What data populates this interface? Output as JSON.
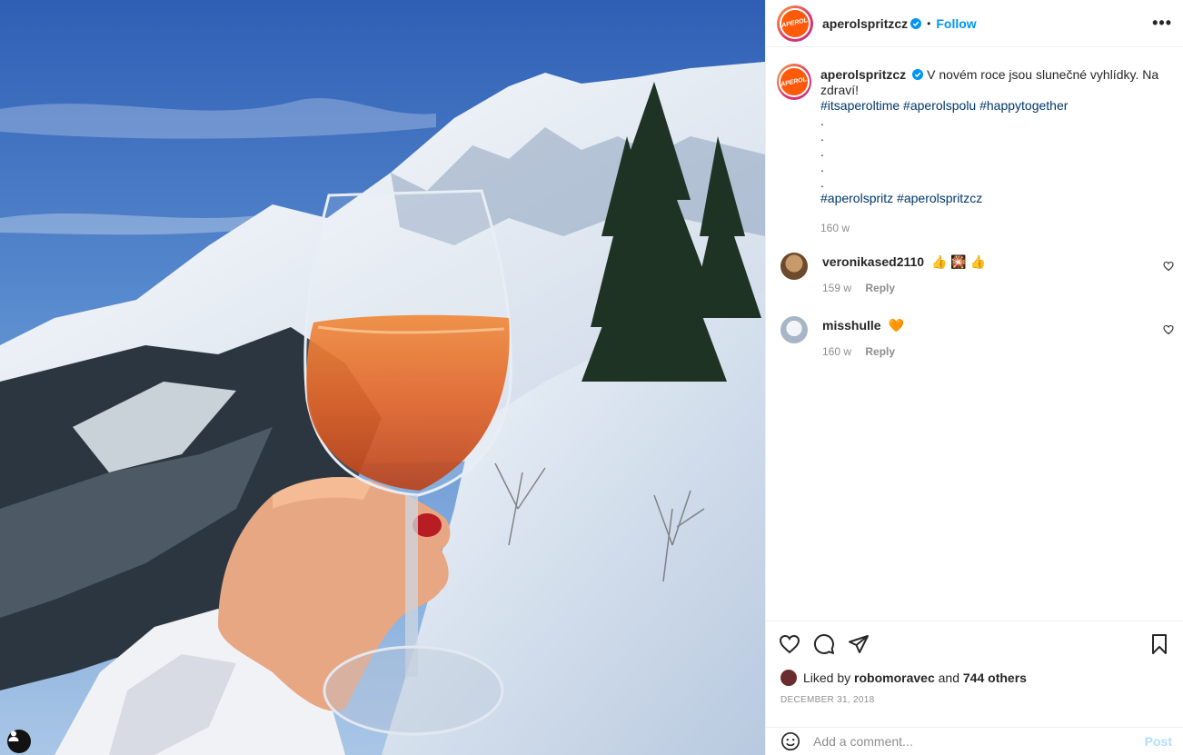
{
  "photo": {
    "alt_icon": "user-tag-icon"
  },
  "header": {
    "avatar_text": "APEROL",
    "username": "aperolspritzcz",
    "dot": "•",
    "follow_label": "Follow",
    "more_label": "•••"
  },
  "caption": {
    "avatar_text": "APEROL",
    "username": "aperolspritzcz",
    "text": "V novém roce jsou slunečné vyhlídky. Na zdraví!",
    "tags_line1": [
      "#itsaperoltime",
      "#aperolspolu",
      "#happytogether"
    ],
    "dots": [
      ".",
      ".",
      ".",
      ".",
      "."
    ],
    "tags_line2": [
      "#aperolspritz",
      "#aperolspritzcz"
    ],
    "time": "160 w"
  },
  "comments": [
    {
      "username": "veronikased2110",
      "text": "👍 🎇 👍",
      "time": "159 w",
      "reply": "Reply"
    },
    {
      "username": "misshulle",
      "text": "🧡",
      "time": "160 w",
      "reply": "Reply"
    }
  ],
  "likes": {
    "prefix": "Liked by",
    "user": "robomoravec",
    "and": "and",
    "others": "744 others"
  },
  "date": "DECEMBER 31, 2018",
  "comment_box": {
    "placeholder": "Add a comment...",
    "post_label": "Post"
  },
  "colors": {
    "brand": "#ff5a0a",
    "link": "#00376b",
    "follow": "#0095f6"
  }
}
